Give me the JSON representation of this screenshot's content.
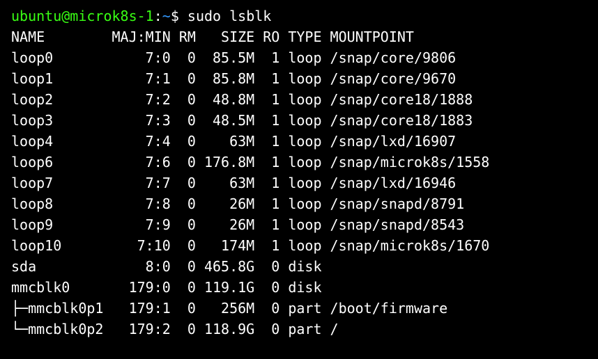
{
  "prompt": {
    "user": "ubuntu",
    "host": "microk8s-1",
    "path": "~",
    "symbol": "$"
  },
  "command": "sudo lsblk",
  "headers": {
    "name": "NAME",
    "majmin": "MAJ:MIN",
    "rm": "RM",
    "size": "SIZE",
    "ro": "RO",
    "type": "TYPE",
    "mountpoint": "MOUNTPOINT"
  },
  "rows": [
    {
      "tree": "",
      "name": "loop0",
      "majmin": "7:0",
      "rm": "0",
      "size": "85.5M",
      "ro": "1",
      "type": "loop",
      "mountpoint": "/snap/core/9806"
    },
    {
      "tree": "",
      "name": "loop1",
      "majmin": "7:1",
      "rm": "0",
      "size": "85.8M",
      "ro": "1",
      "type": "loop",
      "mountpoint": "/snap/core/9670"
    },
    {
      "tree": "",
      "name": "loop2",
      "majmin": "7:2",
      "rm": "0",
      "size": "48.8M",
      "ro": "1",
      "type": "loop",
      "mountpoint": "/snap/core18/1888"
    },
    {
      "tree": "",
      "name": "loop3",
      "majmin": "7:3",
      "rm": "0",
      "size": "48.5M",
      "ro": "1",
      "type": "loop",
      "mountpoint": "/snap/core18/1883"
    },
    {
      "tree": "",
      "name": "loop4",
      "majmin": "7:4",
      "rm": "0",
      "size": "63M",
      "ro": "1",
      "type": "loop",
      "mountpoint": "/snap/lxd/16907"
    },
    {
      "tree": "",
      "name": "loop6",
      "majmin": "7:6",
      "rm": "0",
      "size": "176.8M",
      "ro": "1",
      "type": "loop",
      "mountpoint": "/snap/microk8s/1558"
    },
    {
      "tree": "",
      "name": "loop7",
      "majmin": "7:7",
      "rm": "0",
      "size": "63M",
      "ro": "1",
      "type": "loop",
      "mountpoint": "/snap/lxd/16946"
    },
    {
      "tree": "",
      "name": "loop8",
      "majmin": "7:8",
      "rm": "0",
      "size": "26M",
      "ro": "1",
      "type": "loop",
      "mountpoint": "/snap/snapd/8791"
    },
    {
      "tree": "",
      "name": "loop9",
      "majmin": "7:9",
      "rm": "0",
      "size": "26M",
      "ro": "1",
      "type": "loop",
      "mountpoint": "/snap/snapd/8543"
    },
    {
      "tree": "",
      "name": "loop10",
      "majmin": "7:10",
      "rm": "0",
      "size": "174M",
      "ro": "1",
      "type": "loop",
      "mountpoint": "/snap/microk8s/1670"
    },
    {
      "tree": "",
      "name": "sda",
      "majmin": "8:0",
      "rm": "0",
      "size": "465.8G",
      "ro": "0",
      "type": "disk",
      "mountpoint": ""
    },
    {
      "tree": "",
      "name": "mmcblk0",
      "majmin": "179:0",
      "rm": "0",
      "size": "119.1G",
      "ro": "0",
      "type": "disk",
      "mountpoint": ""
    },
    {
      "tree": "├─",
      "name": "mmcblk0p1",
      "majmin": "179:1",
      "rm": "0",
      "size": "256M",
      "ro": "0",
      "type": "part",
      "mountpoint": "/boot/firmware"
    },
    {
      "tree": "└─",
      "name": "mmcblk0p2",
      "majmin": "179:2",
      "rm": "0",
      "size": "118.9G",
      "ro": "0",
      "type": "part",
      "mountpoint": "/"
    }
  ],
  "widths": {
    "name": 11,
    "majmin": 7,
    "rm": 2,
    "size": 6,
    "ro": 2,
    "type": 4
  }
}
